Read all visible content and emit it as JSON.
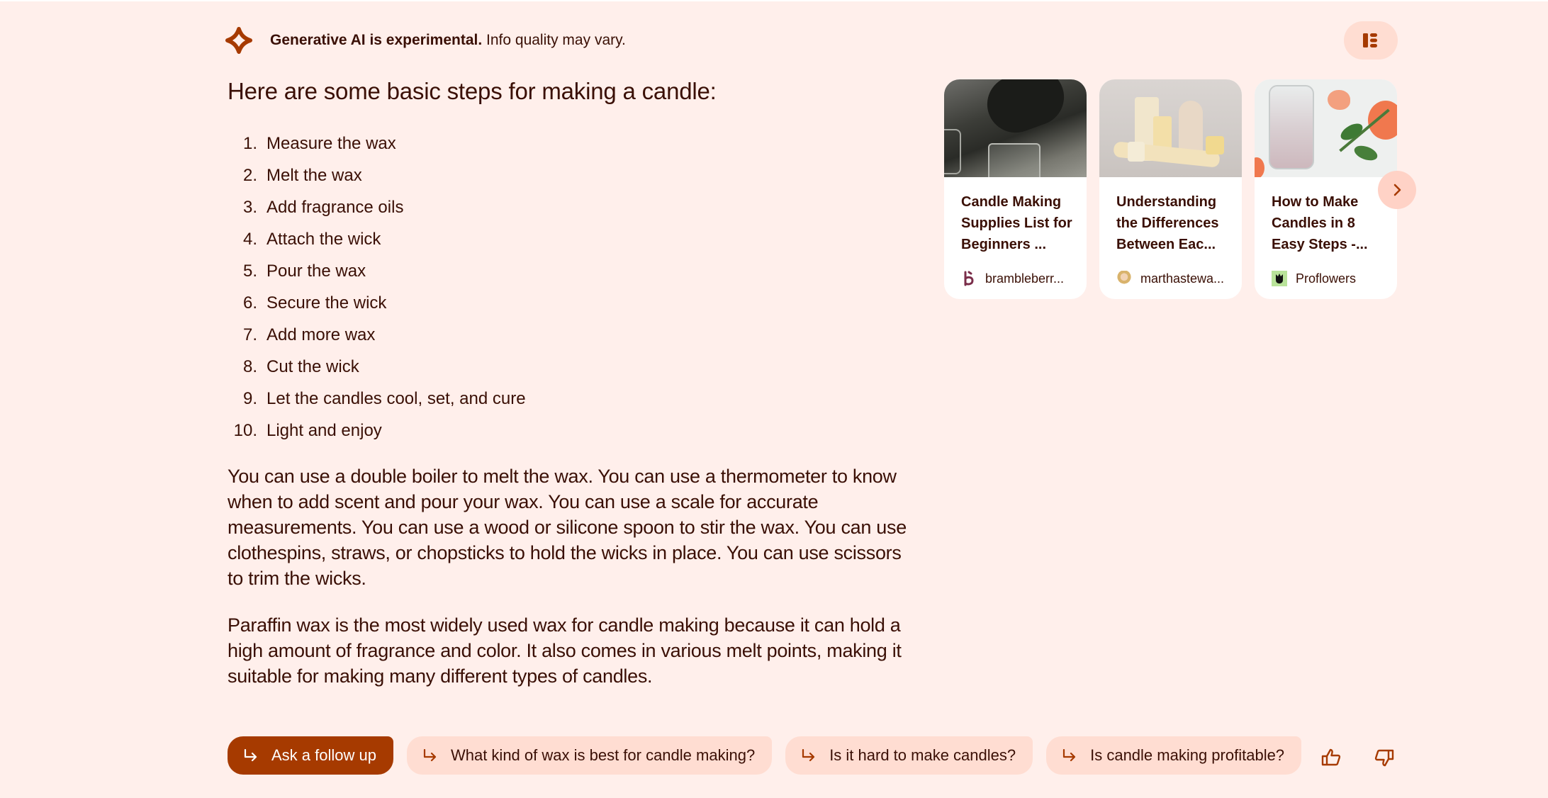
{
  "header": {
    "notice_bold": "Generative AI is experimental.",
    "notice_rest": " Info quality may vary.",
    "logo_icon": "sparkle-icon",
    "panel_toggle_icon": "side-panel-icon"
  },
  "answer": {
    "heading": "Here are some basic steps for making a candle:",
    "steps": [
      {
        "num": "1.",
        "text": "Measure the wax"
      },
      {
        "num": "2.",
        "text": "Melt the wax"
      },
      {
        "num": "3.",
        "text": "Add fragrance oils"
      },
      {
        "num": "4.",
        "text": "Attach the wick"
      },
      {
        "num": "5.",
        "text": "Pour the wax"
      },
      {
        "num": "6.",
        "text": "Secure the wick"
      },
      {
        "num": "7.",
        "text": "Add more wax"
      },
      {
        "num": "8.",
        "text": "Cut the wick"
      },
      {
        "num": "9.",
        "text": "Let the candles cool, set, and cure"
      },
      {
        "num": "10.",
        "text": "Light and enjoy"
      }
    ],
    "paragraphs": [
      "You can use a double boiler to melt the wax. You can use a thermometer to know when to add scent and pour your wax. You can use a scale for accurate measurements. You can use a wood or silicone spoon to stir the wax. You can use clothespins, straws, or chopsticks to hold the wicks in place. You can use scissors to trim the wicks.",
      "Paraffin wax is the most widely used wax for candle making because it can hold a high amount of fragrance and color. It also comes in various melt points, making it suitable for making many different types of candles."
    ]
  },
  "sources": {
    "cards": [
      {
        "title": "Candle Making Supplies List for Beginners ...",
        "source": "brambleberr...",
        "favicon": "brambleberry-favicon",
        "image": "pouring-wax-photo"
      },
      {
        "title": "Understanding the Differences Between Eac...",
        "source": "marthastewa...",
        "favicon": "marthastewart-favicon",
        "image": "beeswax-candles-photo"
      },
      {
        "title": "How to Make Candles in 8 Easy Steps -...",
        "source": "Proflowers",
        "favicon": "proflowers-favicon",
        "image": "jar-candle-roses-photo"
      }
    ],
    "next_icon": "chevron-right-icon"
  },
  "followups": {
    "ask_label": "Ask a follow up",
    "suggestions": [
      "What kind of wax is best for candle making?",
      "Is it hard to make candles?",
      "Is candle making profitable?"
    ]
  },
  "feedback": {
    "thumbs_up_icon": "thumbs-up-icon",
    "thumbs_down_icon": "thumbs-down-icon"
  },
  "colors": {
    "background": "#FFEFEB",
    "accent": "#A63A00",
    "chip_bg": "#FFDDD2",
    "text": "#3A0F05"
  }
}
